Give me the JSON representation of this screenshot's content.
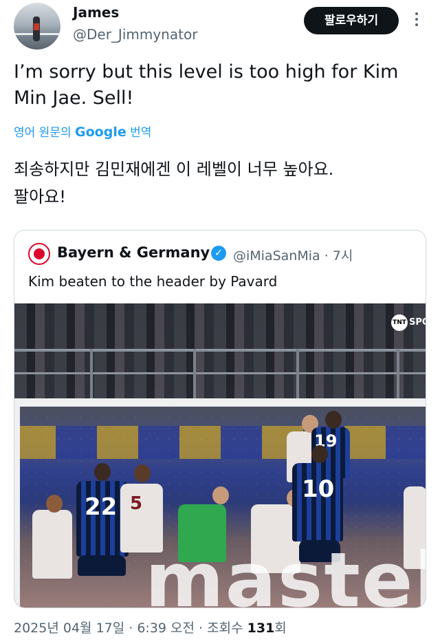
{
  "author": {
    "name": "James",
    "handle": "@Der_Jimmynator"
  },
  "follow_button": "팔로우하기",
  "tweet": {
    "text_line1": "I’m sorry but this level is too high for Kim",
    "text_line2": "Min Jae. Sell!",
    "translate_prefix": "영어 원문의 ",
    "translate_brand": "Google",
    "translate_suffix": " 번역",
    "translation_line1": "죄송하지만 김민재에겐 이 레벨이 너무 높아요.",
    "translation_line2": "팔아요!"
  },
  "quoted": {
    "name": "Bayern & Germany",
    "verified_glyph": "✓",
    "handle_time": "@iMiaSanMia · 7시",
    "text": "Kim beaten to the header by Pavard",
    "media": {
      "broadcaster_logo": "TNT",
      "broadcaster_text": "SPO",
      "jersey_22": "22",
      "jersey_10": "10",
      "jersey_19": "19",
      "jersey_5": "5",
      "ad_board_text": "mastel"
    }
  },
  "meta": {
    "timestamp": "2025년 04월 17일 · 6:39 오전 · 조회수 ",
    "views": "131",
    "views_suffix": "회"
  },
  "colors": {
    "link_blue": "#1d9bf0",
    "text_primary": "#0f1419",
    "text_secondary": "#536471"
  },
  "icons": [
    "more-vertical-icon",
    "verified-badge-icon"
  ]
}
